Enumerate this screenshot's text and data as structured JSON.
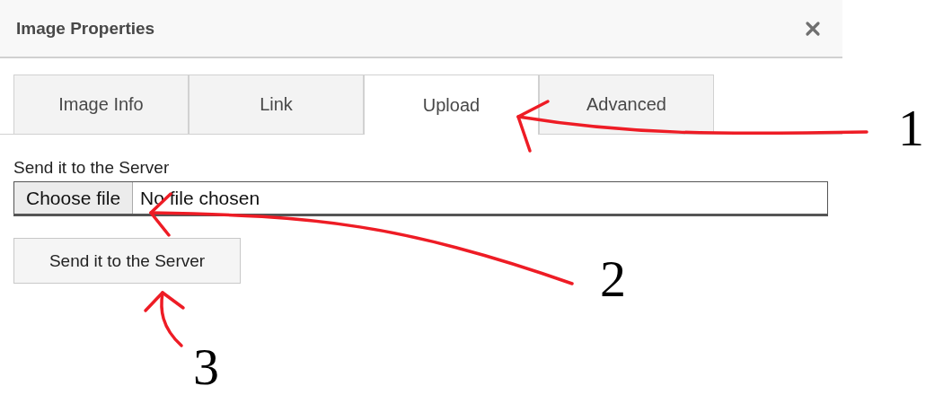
{
  "dialog": {
    "title": "Image Properties"
  },
  "tabs": [
    {
      "label": "Image Info",
      "selected": false
    },
    {
      "label": "Link",
      "selected": false
    },
    {
      "label": "Upload",
      "selected": true
    },
    {
      "label": "Advanced",
      "selected": false
    }
  ],
  "upload": {
    "label": "Send it to the Server",
    "file_button": "Choose file",
    "file_status": "No file chosen",
    "send_button": "Send it to the Server"
  },
  "annotations": [
    {
      "label": "1"
    },
    {
      "label": "2"
    },
    {
      "label": "3"
    }
  ]
}
